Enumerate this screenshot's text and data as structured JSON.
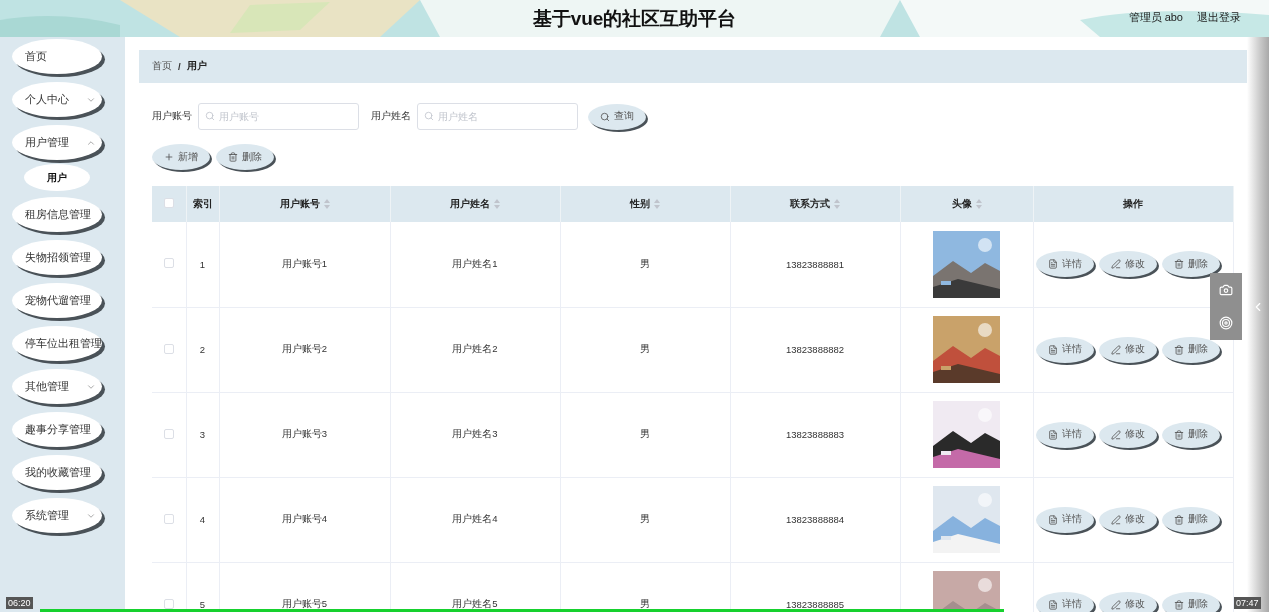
{
  "header": {
    "title": "基于vue的社区互助平台",
    "user": "管理员 abo",
    "logout": "退出登录"
  },
  "sidebar": {
    "items": [
      {
        "label": "首页",
        "expandable": false,
        "selected": false
      },
      {
        "label": "个人中心",
        "expandable": true,
        "expanded": false,
        "selected": false
      },
      {
        "label": "用户管理",
        "expandable": true,
        "expanded": true,
        "selected": false,
        "children": [
          {
            "label": "用户",
            "selected": true
          }
        ]
      },
      {
        "label": "租房信息管理",
        "expandable": false,
        "selected": false
      },
      {
        "label": "失物招领管理",
        "expandable": false,
        "selected": false
      },
      {
        "label": "宠物代遛管理",
        "expandable": false,
        "selected": false
      },
      {
        "label": "停车位出租管理",
        "expandable": false,
        "selected": false
      },
      {
        "label": "其他管理",
        "expandable": true,
        "expanded": false,
        "selected": false
      },
      {
        "label": "趣事分享管理",
        "expandable": false,
        "selected": false
      },
      {
        "label": "我的收藏管理",
        "expandable": false,
        "selected": false
      },
      {
        "label": "系统管理",
        "expandable": true,
        "expanded": false,
        "selected": false
      }
    ]
  },
  "breadcrumb": {
    "items": [
      "首页",
      "用户"
    ],
    "separator": "/"
  },
  "search": {
    "fields": [
      {
        "label": "用户账号",
        "placeholder": "用户账号"
      },
      {
        "label": "用户姓名",
        "placeholder": "用户姓名"
      }
    ],
    "button": "查询"
  },
  "toolbar": [
    {
      "label": "新增",
      "kind": "add"
    },
    {
      "label": "删除",
      "kind": "delete"
    }
  ],
  "table": {
    "select_all": {
      "checked": false
    },
    "columns": [
      {
        "label": "索引",
        "sortable": false
      },
      {
        "label": "用户账号",
        "sortable": true
      },
      {
        "label": "用户姓名",
        "sortable": true
      },
      {
        "label": "性别",
        "sortable": true
      },
      {
        "label": "联系方式",
        "sortable": true
      },
      {
        "label": "头像",
        "sortable": true
      },
      {
        "label": "操作",
        "sortable": false
      }
    ],
    "rows": [
      {
        "checked": false,
        "index": "1",
        "account": "用户账号1",
        "name": "用户姓名1",
        "gender": "男",
        "phone": "13823888881",
        "actions": [
          {
            "label": "详情",
            "kind": "detail"
          },
          {
            "label": "修改",
            "kind": "edit"
          },
          {
            "label": "删除",
            "kind": "delete"
          }
        ]
      },
      {
        "checked": false,
        "index": "2",
        "account": "用户账号2",
        "name": "用户姓名2",
        "gender": "男",
        "phone": "13823888882",
        "actions": [
          {
            "label": "详情",
            "kind": "detail"
          },
          {
            "label": "修改",
            "kind": "edit"
          },
          {
            "label": "删除",
            "kind": "delete"
          }
        ]
      },
      {
        "checked": false,
        "index": "3",
        "account": "用户账号3",
        "name": "用户姓名3",
        "gender": "男",
        "phone": "13823888883",
        "actions": [
          {
            "label": "详情",
            "kind": "detail"
          },
          {
            "label": "修改",
            "kind": "edit"
          },
          {
            "label": "删除",
            "kind": "delete"
          }
        ]
      },
      {
        "checked": false,
        "index": "4",
        "account": "用户账号4",
        "name": "用户姓名4",
        "gender": "男",
        "phone": "13823888884",
        "actions": [
          {
            "label": "详情",
            "kind": "detail"
          },
          {
            "label": "修改",
            "kind": "edit"
          },
          {
            "label": "删除",
            "kind": "delete"
          }
        ]
      },
      {
        "checked": false,
        "index": "5",
        "account": "用户账号5",
        "name": "用户姓名5",
        "gender": "男",
        "phone": "13823888885",
        "actions": [
          {
            "label": "详情",
            "kind": "detail"
          },
          {
            "label": "修改",
            "kind": "edit"
          },
          {
            "label": "删除",
            "kind": "delete"
          }
        ]
      }
    ]
  },
  "player": {
    "elapsed": "06:20",
    "total": "07:47",
    "level": 0.81
  }
}
